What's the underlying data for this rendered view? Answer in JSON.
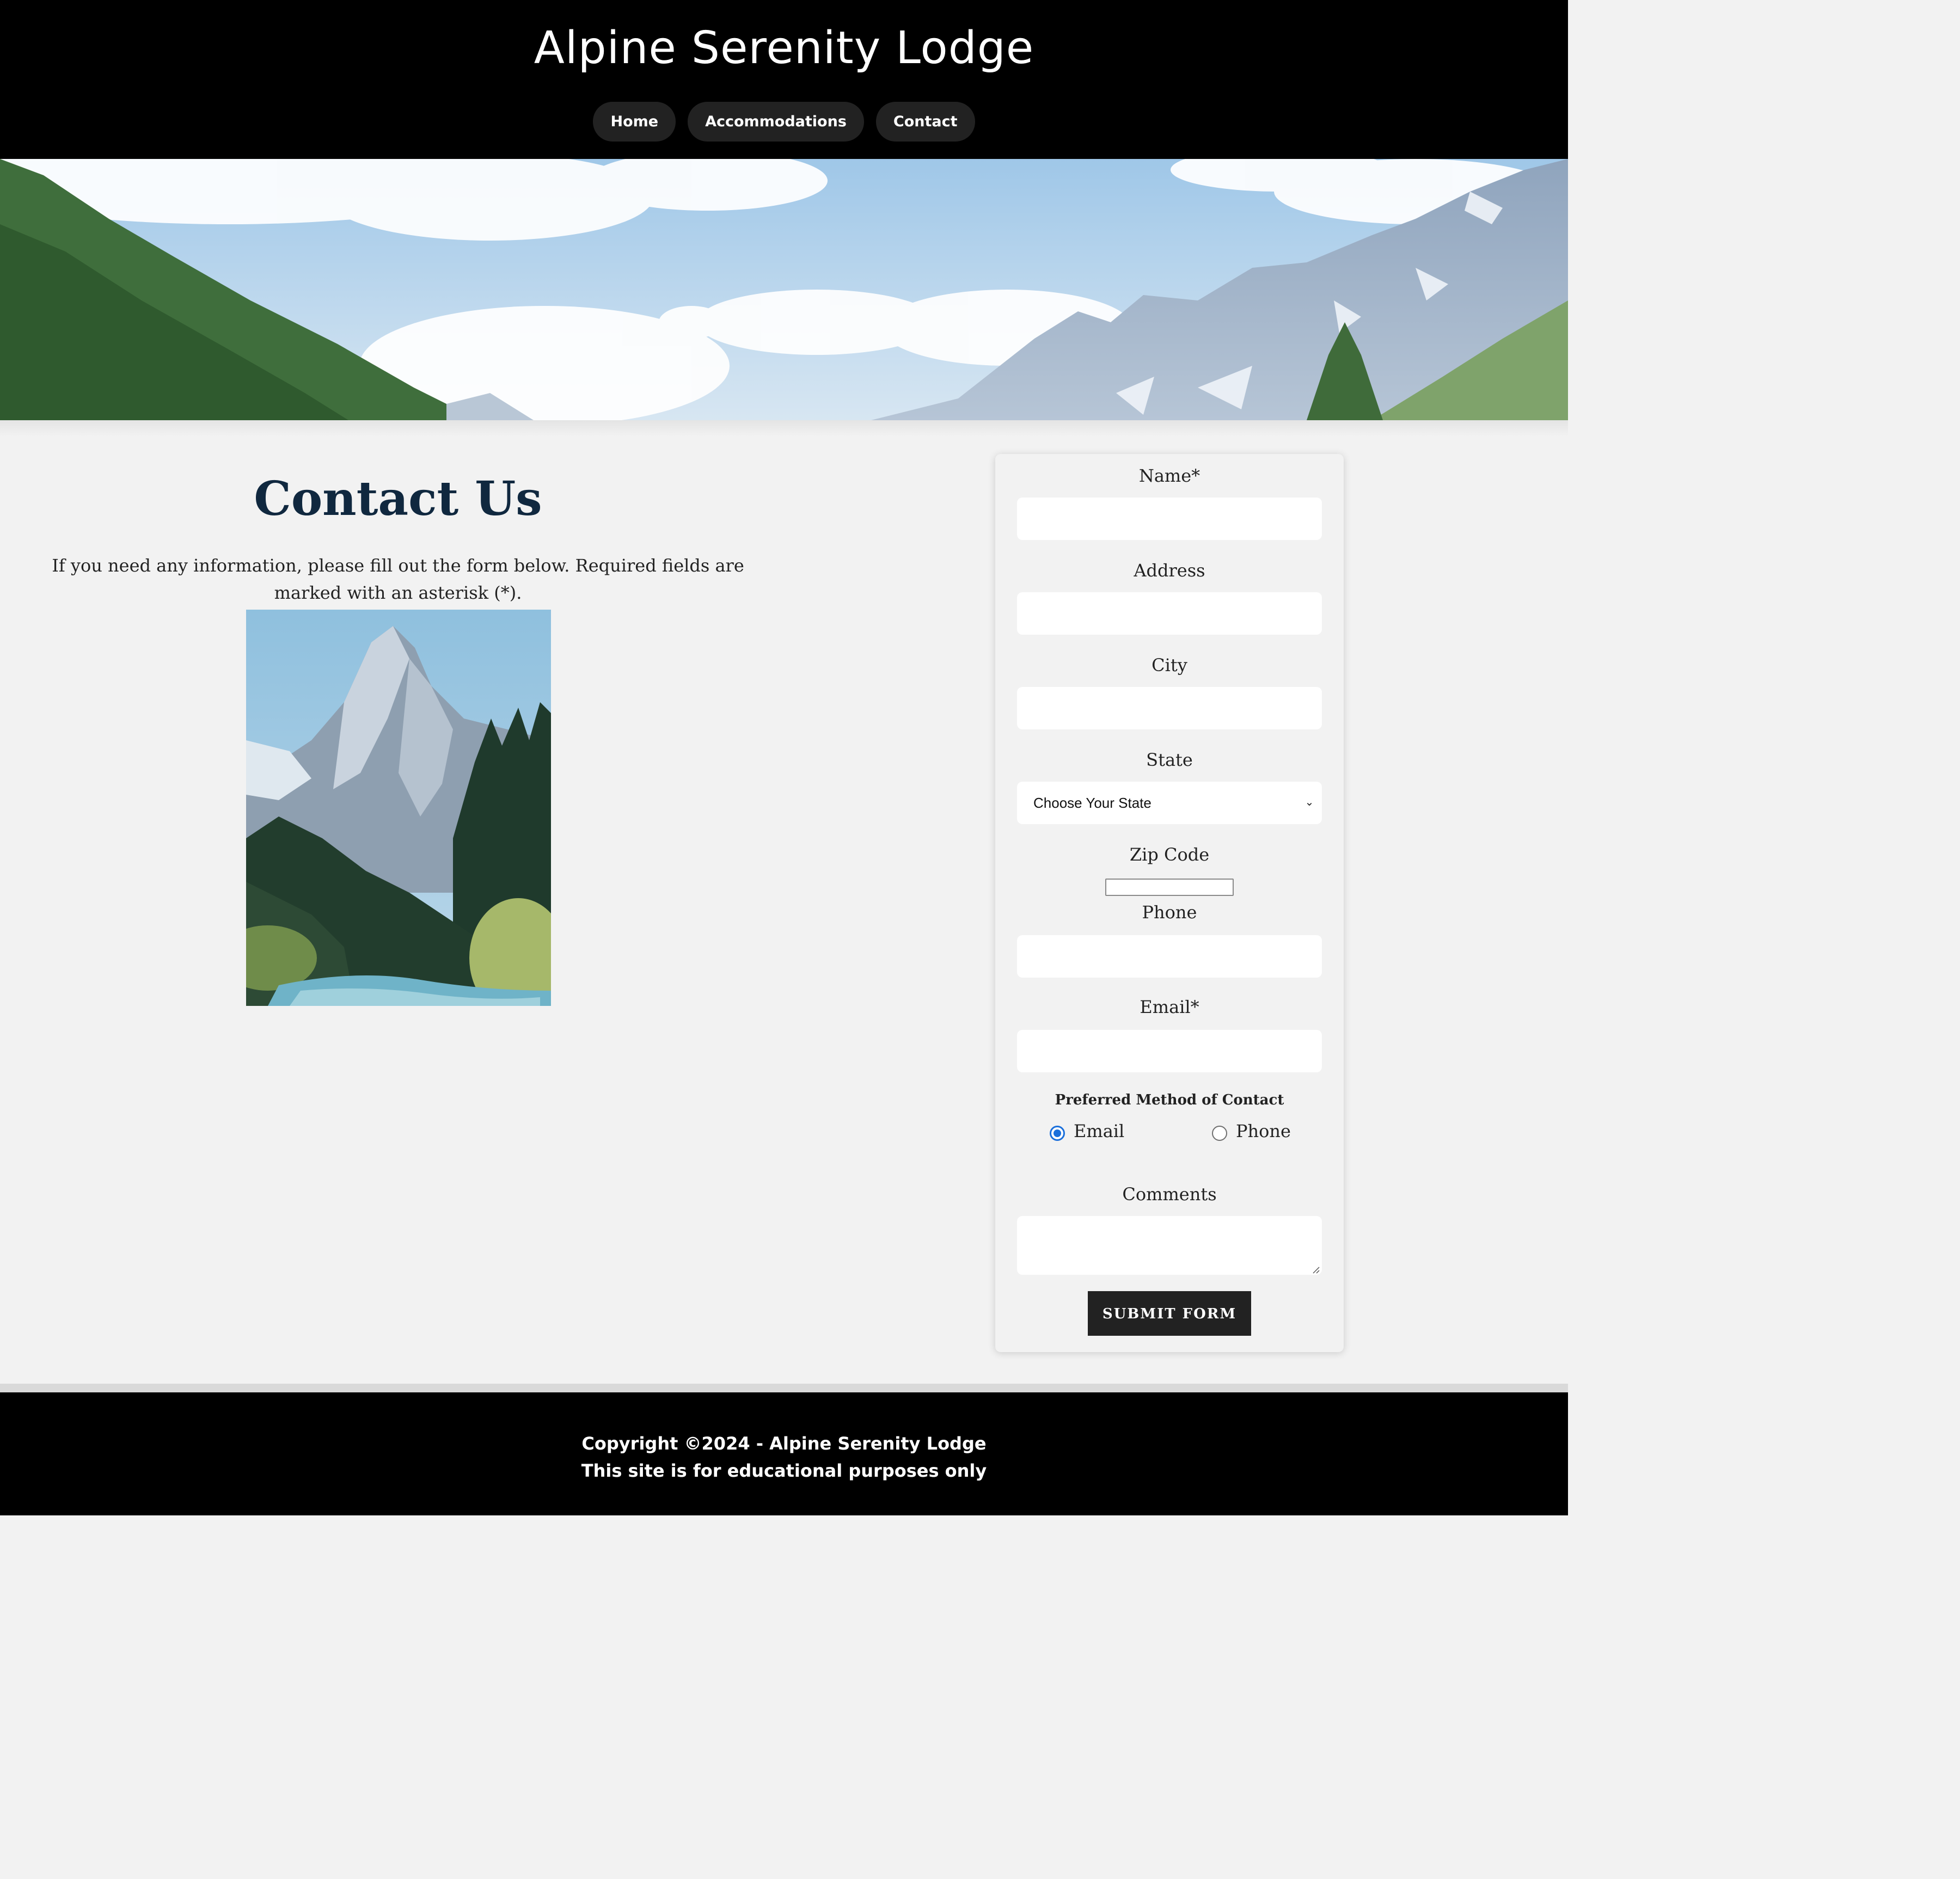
{
  "header": {
    "title": "Alpine Serenity Lodge",
    "nav": [
      {
        "label": "Home"
      },
      {
        "label": "Accommodations"
      },
      {
        "label": "Contact"
      }
    ]
  },
  "main": {
    "heading": "Contact Us",
    "intro": "If you need any information, please fill out the form below. Required fields are marked with an asterisk (*)."
  },
  "form": {
    "name_label": "Name*",
    "address_label": "Address",
    "city_label": "City",
    "state_label": "State",
    "state_selected": "Choose Your State",
    "zip_label": "Zip Code",
    "phone_label": "Phone",
    "email_label": "Email*",
    "preferred_legend": "Preferred Method of Contact",
    "preferred_options": [
      {
        "label": "Email",
        "checked": true
      },
      {
        "label": "Phone",
        "checked": false
      }
    ],
    "comments_label": "Comments",
    "submit_label": "SUBMIT FORM"
  },
  "footer": {
    "copyright": "Copyright ©2024 - Alpine Serenity Lodge",
    "note": "This site is for educational purposes only"
  },
  "colors": {
    "header_bg": "#000000",
    "nav_pill_bg": "#222222",
    "page_bg": "#f2f2f2",
    "heading": "#10283f",
    "radio_accent": "#1a6fdb",
    "button_bg": "#222222"
  }
}
